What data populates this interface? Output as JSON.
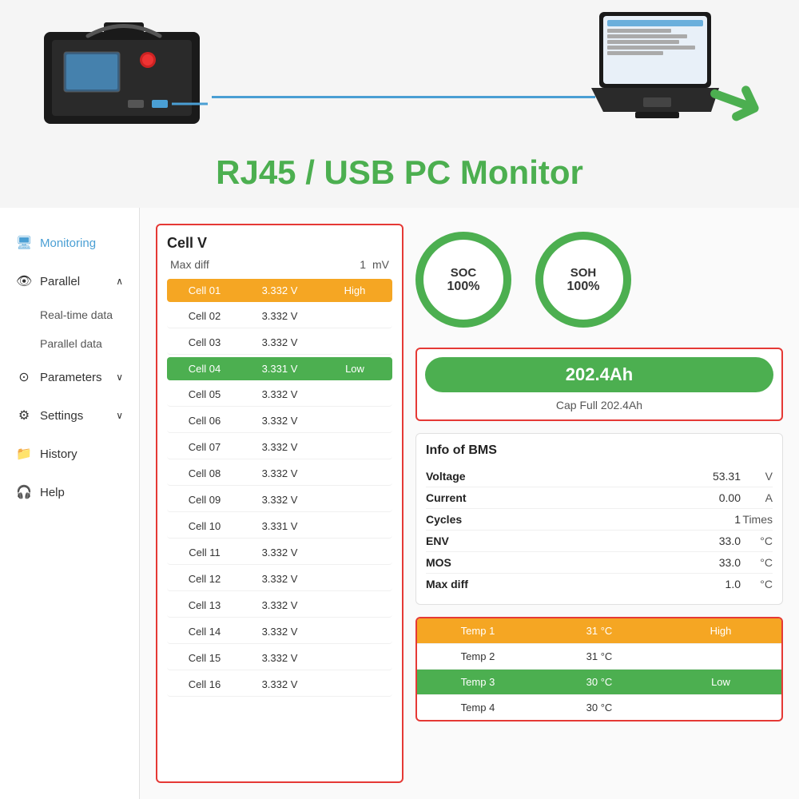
{
  "header": {
    "title": "RJ45 / USB PC Monitor"
  },
  "sidebar": {
    "items": [
      {
        "id": "monitoring",
        "label": "Monitoring",
        "icon": "🖥",
        "active": true
      },
      {
        "id": "parallel",
        "label": "Parallel",
        "icon": "👁",
        "chevron": "∧"
      },
      {
        "id": "realtime",
        "label": "Real-time data"
      },
      {
        "id": "paralleldata",
        "label": "Parallel data"
      },
      {
        "id": "parameters",
        "label": "Parameters",
        "icon": "⊙",
        "chevron": "∨"
      },
      {
        "id": "settings",
        "label": "Settings",
        "icon": "⚙",
        "chevron": "∨"
      },
      {
        "id": "history",
        "label": "History",
        "icon": "📁"
      },
      {
        "id": "help",
        "label": "Help",
        "icon": "🎧"
      }
    ]
  },
  "cell_panel": {
    "title": "Cell V",
    "maxdiff_label": "Max diff",
    "maxdiff_value": "1",
    "maxdiff_unit": "mV",
    "cells": [
      {
        "name": "Cell 01",
        "voltage": "3.332 V",
        "status": "High",
        "style": "orange"
      },
      {
        "name": "Cell 02",
        "voltage": "3.332 V",
        "status": "",
        "style": "plain"
      },
      {
        "name": "Cell 03",
        "voltage": "3.332 V",
        "status": "",
        "style": "plain"
      },
      {
        "name": "Cell 04",
        "voltage": "3.331 V",
        "status": "Low",
        "style": "green"
      },
      {
        "name": "Cell 05",
        "voltage": "3.332 V",
        "status": "",
        "style": "plain"
      },
      {
        "name": "Cell 06",
        "voltage": "3.332 V",
        "status": "",
        "style": "plain"
      },
      {
        "name": "Cell 07",
        "voltage": "3.332 V",
        "status": "",
        "style": "plain"
      },
      {
        "name": "Cell 08",
        "voltage": "3.332 V",
        "status": "",
        "style": "plain"
      },
      {
        "name": "Cell 09",
        "voltage": "3.332 V",
        "status": "",
        "style": "plain"
      },
      {
        "name": "Cell 10",
        "voltage": "3.331 V",
        "status": "",
        "style": "plain"
      },
      {
        "name": "Cell 11",
        "voltage": "3.332 V",
        "status": "",
        "style": "plain"
      },
      {
        "name": "Cell 12",
        "voltage": "3.332 V",
        "status": "",
        "style": "plain"
      },
      {
        "name": "Cell 13",
        "voltage": "3.332 V",
        "status": "",
        "style": "plain"
      },
      {
        "name": "Cell 14",
        "voltage": "3.332 V",
        "status": "",
        "style": "plain"
      },
      {
        "name": "Cell 15",
        "voltage": "3.332 V",
        "status": "",
        "style": "plain"
      },
      {
        "name": "Cell 16",
        "voltage": "3.332 V",
        "status": "",
        "style": "plain"
      }
    ]
  },
  "gauges": {
    "soc": {
      "label": "SOC",
      "value": "100%"
    },
    "soh": {
      "label": "SOH",
      "value": "100%"
    }
  },
  "capacity": {
    "value": "202.4Ah",
    "sub": "Cap Full 202.4Ah"
  },
  "bms": {
    "title": "Info of BMS",
    "rows": [
      {
        "label": "Voltage",
        "value": "53.31",
        "unit": "V"
      },
      {
        "label": "Current",
        "value": "0.00",
        "unit": "A"
      },
      {
        "label": "Cycles",
        "value": "1",
        "unit": "Times"
      },
      {
        "label": "ENV",
        "value": "33.0",
        "unit": "°C"
      },
      {
        "label": "MOS",
        "value": "33.0",
        "unit": "°C"
      },
      {
        "label": "Max diff",
        "value": "1.0",
        "unit": "°C"
      }
    ]
  },
  "temps": [
    {
      "name": "Temp 1",
      "value": "31 °C",
      "status": "High",
      "style": "orange"
    },
    {
      "name": "Temp 2",
      "value": "31 °C",
      "status": "",
      "style": "plain"
    },
    {
      "name": "Temp 3",
      "value": "30 °C",
      "status": "Low",
      "style": "green"
    },
    {
      "name": "Temp 4",
      "value": "30 °C",
      "status": "",
      "style": "plain"
    }
  ]
}
